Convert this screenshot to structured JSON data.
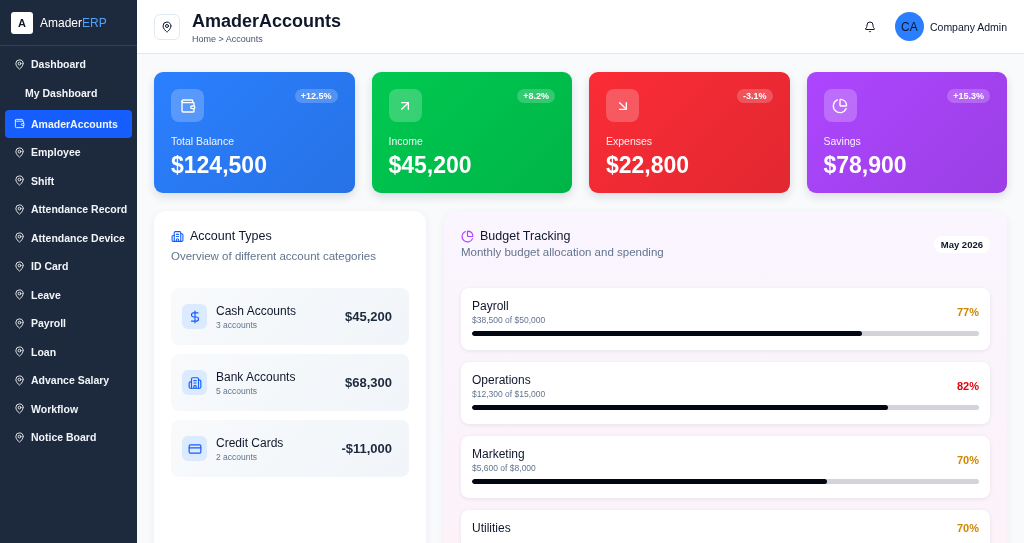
{
  "sidebar": {
    "logo": {
      "mark": "A",
      "name": "Amader",
      "accent": "ERP"
    },
    "items": [
      {
        "label": "Dashboard",
        "kind": "link",
        "selected": false,
        "children": [
          {
            "label": "My Dashboard",
            "selected": false
          }
        ]
      },
      {
        "label": "AmaderAccounts",
        "kind": "accounts",
        "selected": true
      },
      {
        "label": "Employee",
        "kind": "link",
        "selected": false
      },
      {
        "label": "Shift",
        "kind": "link",
        "selected": false
      },
      {
        "label": "Attendance Record",
        "kind": "link",
        "selected": false
      },
      {
        "label": "Attendance Device",
        "kind": "link",
        "selected": false
      },
      {
        "label": "ID Card",
        "kind": "link",
        "selected": false
      },
      {
        "label": "Leave",
        "kind": "link",
        "selected": false
      },
      {
        "label": "Payroll",
        "kind": "link",
        "selected": false
      },
      {
        "label": "Loan",
        "kind": "link",
        "selected": false
      },
      {
        "label": "Advance Salary",
        "kind": "link",
        "selected": false
      },
      {
        "label": "Workflow",
        "kind": "link",
        "selected": false
      },
      {
        "label": "Notice Board",
        "kind": "link",
        "selected": false
      }
    ]
  },
  "header": {
    "title": "AmaderAccounts",
    "breadcrumb": "Home > Accounts",
    "user": {
      "initials": "CA",
      "name": "Company Admin"
    }
  },
  "stats": [
    {
      "kind": "balance",
      "label": "Total Balance",
      "value": "$124,500",
      "change": "+12.5%",
      "color": "#2b7fff"
    },
    {
      "kind": "income",
      "label": "Income",
      "value": "$45,200",
      "change": "+8.2%",
      "color": "#00c950"
    },
    {
      "kind": "expense",
      "label": "Expenses",
      "value": "$22,800",
      "change": "-3.1%",
      "color": "#fb2c36"
    },
    {
      "kind": "savings",
      "label": "Savings",
      "value": "$78,900",
      "change": "+15.3%",
      "color": "#ad46ff"
    }
  ],
  "account_types": {
    "title": "Account Types",
    "subtitle": "Overview of different account categories",
    "items": [
      {
        "kind": "cash",
        "name": "Cash Accounts",
        "count": "3 accounts",
        "amount": "$45,200"
      },
      {
        "kind": "bank",
        "name": "Bank Accounts",
        "count": "5 accounts",
        "amount": "$68,300"
      },
      {
        "kind": "card",
        "name": "Credit Cards",
        "count": "2 accounts",
        "amount": "-$11,000"
      }
    ]
  },
  "budget": {
    "title": "Budget Tracking",
    "subtitle": "Monthly budget allocation and spending",
    "period": "May 2026",
    "items": [
      {
        "name": "Payroll",
        "detail": "$38,500 of $50,000",
        "percent": "77%",
        "color": "#d08700",
        "level": 0.77
      },
      {
        "name": "Operations",
        "detail": "$12,300 of $15,000",
        "percent": "82%",
        "color": "#e7000b",
        "level": 0.82
      },
      {
        "name": "Marketing",
        "detail": "$5,600 of $8,000",
        "percent": "70%",
        "color": "#d08700",
        "level": 0.7
      },
      {
        "name": "Utilities",
        "percent": "70%",
        "color": "#d08700"
      }
    ]
  }
}
